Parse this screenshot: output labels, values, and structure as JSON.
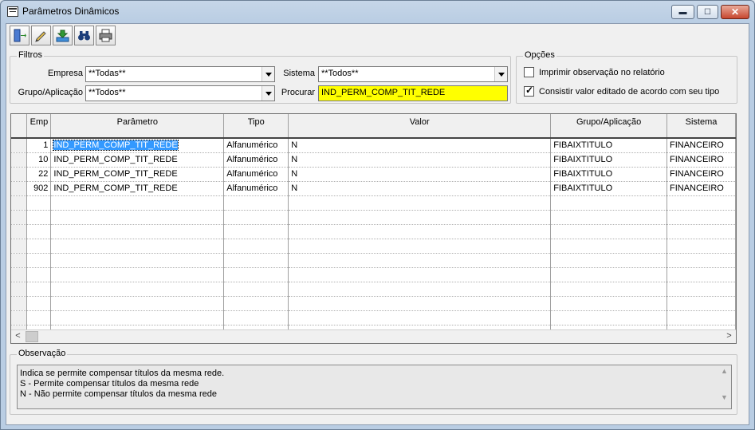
{
  "window": {
    "title": "Parâmetros Dinâmicos",
    "min_glyph": "▬",
    "max_glyph": "☐",
    "close_glyph": "✕"
  },
  "toolbar": {
    "buttons": [
      {
        "name": "exit-button",
        "icon": "exit-door-icon"
      },
      {
        "name": "edit-button",
        "icon": "pencil-icon"
      },
      {
        "name": "export-button",
        "icon": "download-tray-icon"
      },
      {
        "name": "find-button",
        "icon": "binoculars-icon"
      },
      {
        "name": "print-button",
        "icon": "printer-icon"
      }
    ]
  },
  "filters": {
    "legend": "Filtros",
    "empresa_label": "Empresa",
    "empresa_value": "**Todas**",
    "sistema_label": "Sistema",
    "sistema_value": "**Todos**",
    "grupo_label": "Grupo/Aplicação",
    "grupo_value": "**Todos**",
    "procurar_label": "Procurar",
    "procurar_value": "IND_PERM_COMP_TIT_REDE"
  },
  "options": {
    "legend": "Opções",
    "opt1_label": "Imprimir observação no relatório",
    "opt1_checked": false,
    "opt2_label": "Consistir valor editado de acordo com seu tipo",
    "opt2_checked": true
  },
  "grid": {
    "columns": [
      "Emp",
      "Parâmetro",
      "Tipo",
      "Valor",
      "Grupo/Aplicação",
      "Sistema"
    ],
    "rows": [
      {
        "emp": "1",
        "param": "IND_PERM_COMP_TIT_REDE",
        "tipo": "Alfanumérico",
        "valor": "N",
        "grupo": "FIBAIXTITULO",
        "sistema": "FINANCEIRO"
      },
      {
        "emp": "10",
        "param": "IND_PERM_COMP_TIT_REDE",
        "tipo": "Alfanumérico",
        "valor": "N",
        "grupo": "FIBAIXTITULO",
        "sistema": "FINANCEIRO"
      },
      {
        "emp": "22",
        "param": "IND_PERM_COMP_TIT_REDE",
        "tipo": "Alfanumérico",
        "valor": "N",
        "grupo": "FIBAIXTITULO",
        "sistema": "FINANCEIRO"
      },
      {
        "emp": "902",
        "param": "IND_PERM_COMP_TIT_REDE",
        "tipo": "Alfanumérico",
        "valor": "N",
        "grupo": "FIBAIXTITULO",
        "sistema": "FINANCEIRO"
      }
    ],
    "scroll_left": "<",
    "scroll_right": ">"
  },
  "observacao": {
    "legend": "Observação",
    "line1": "Indica se permite compensar títulos da mesma rede.",
    "line2": "S - Permite compensar títulos da mesma rede",
    "line3": "N - Não permite compensar títulos da mesma rede",
    "scroll_up": "▲",
    "scroll_down": "▼"
  }
}
